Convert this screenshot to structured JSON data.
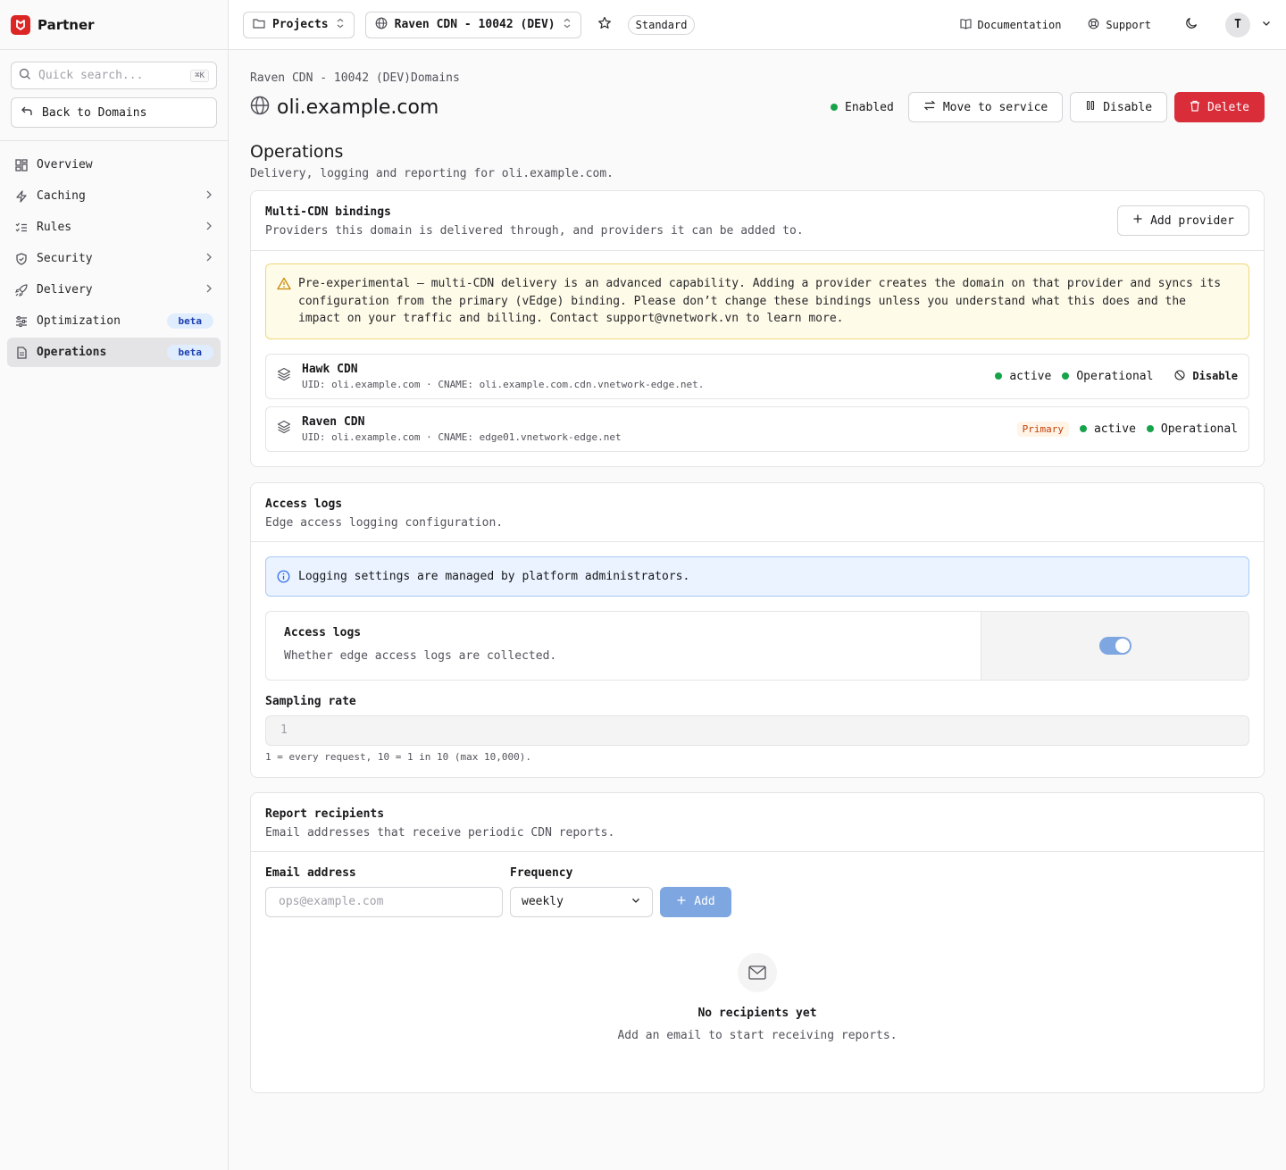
{
  "brand": {
    "name": "Partner",
    "color": "#dc2626"
  },
  "sidebar": {
    "search_placeholder": "Quick search...",
    "search_kbd": "⌘K",
    "back_label": "Back to Domains",
    "items": [
      {
        "label": "Overview",
        "icon": "grid-icon",
        "chevron": false,
        "badge": ""
      },
      {
        "label": "Caching",
        "icon": "bolt-icon",
        "chevron": true,
        "badge": ""
      },
      {
        "label": "Rules",
        "icon": "list-check-icon",
        "chevron": true,
        "badge": ""
      },
      {
        "label": "Security",
        "icon": "shield-icon",
        "chevron": true,
        "badge": ""
      },
      {
        "label": "Delivery",
        "icon": "rocket-icon",
        "chevron": true,
        "badge": ""
      },
      {
        "label": "Optimization",
        "icon": "sliders-icon",
        "chevron": false,
        "badge": "beta"
      },
      {
        "label": "Operations",
        "icon": "file-icon",
        "chevron": false,
        "badge": "beta",
        "active": true
      }
    ]
  },
  "topbar": {
    "projects_label": "Projects",
    "service_label": "Raven CDN - 10042 (DEV)",
    "plan_tag": "Standard",
    "documentation": "Documentation",
    "support": "Support",
    "avatar_initial": "T"
  },
  "page": {
    "breadcrumb": "Raven CDN - 10042 (DEV)Domains",
    "title": "oli.example.com",
    "status": "Enabled",
    "move_label": "Move to service",
    "disable_label": "Disable",
    "delete_label": "Delete",
    "section_title": "Operations",
    "section_desc": "Delivery, logging and reporting for oli.example.com."
  },
  "multicdn": {
    "title": "Multi-CDN bindings",
    "desc": "Providers this domain is delivered through, and providers it can be added to.",
    "add_label": "Add provider",
    "warning": "Pre-experimental — multi-CDN delivery is an advanced capability. Adding a provider creates the domain on that provider and syncs its configuration from the primary (vEdge) binding. Please don’t change these bindings unless you understand what this does and the impact on your traffic and billing. Contact support@vnetwork.vn to learn more.",
    "providers": [
      {
        "name": "Hawk CDN",
        "meta": "UID: oli.example.com · CNAME: oli.example.com.cdn.vnetwork-edge.net.",
        "primary": "",
        "state": "active",
        "health": "Operational",
        "action": "Disable"
      },
      {
        "name": "Raven CDN",
        "meta": "UID: oli.example.com · CNAME: edge01.vnetwork-edge.net",
        "primary": "Primary",
        "state": "active",
        "health": "Operational",
        "action": ""
      }
    ]
  },
  "access_logs": {
    "title": "Access logs",
    "desc": "Edge access logging configuration.",
    "info": "Logging settings are managed by platform administrators.",
    "toggle_title": "Access logs",
    "toggle_desc": "Whether edge access logs are collected.",
    "toggle_on": true,
    "sampling_label": "Sampling rate",
    "sampling_value": "1",
    "sampling_hint": "1 = every request, 10 = 1 in 10 (max 10,000)."
  },
  "reports": {
    "title": "Report recipients",
    "desc": "Email addresses that receive periodic CDN reports.",
    "email_label": "Email address",
    "email_placeholder": "ops@example.com",
    "frequency_label": "Frequency",
    "frequency_value": "weekly",
    "add_label": "Add",
    "empty_title": "No recipients yet",
    "empty_desc": "Add an email to start receiving reports."
  }
}
